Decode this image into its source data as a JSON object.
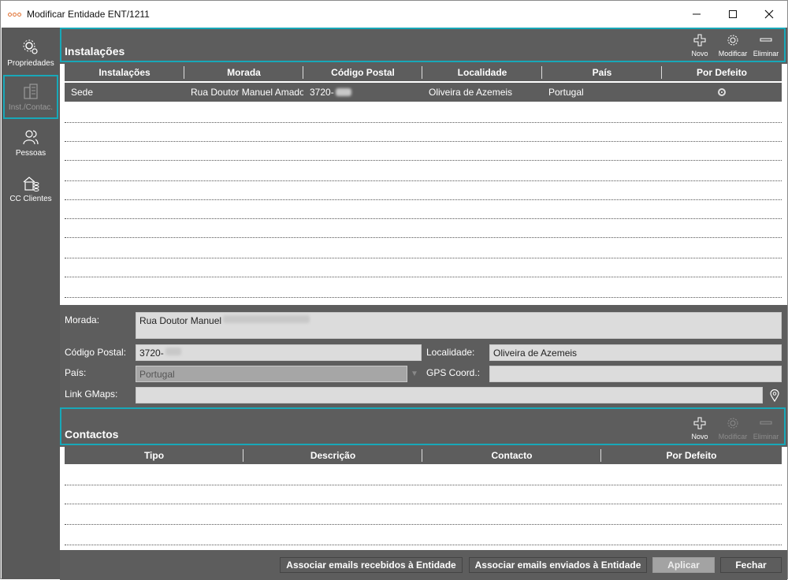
{
  "window": {
    "title": "Modificar Entidade ENT/1211",
    "controls": [
      "minimize-icon",
      "maximize-icon",
      "close-icon"
    ]
  },
  "sidebar": {
    "items": [
      {
        "label": "Propriedades",
        "icon": "gears-icon"
      },
      {
        "label": "Inst./Contac.",
        "icon": "building-icon",
        "active": true
      },
      {
        "label": "Pessoas",
        "icon": "people-icon"
      },
      {
        "label": "CC Clientes",
        "icon": "cc-icon"
      }
    ]
  },
  "instalacoes": {
    "title": "Instalações",
    "tools": {
      "novo": "Novo",
      "modificar": "Modificar",
      "eliminar": "Eliminar"
    },
    "columns": [
      "Instalações",
      "Morada",
      "Código Postal",
      "Localidade",
      "País",
      "Por Defeito"
    ],
    "rows": [
      {
        "instalacao": "Sede",
        "morada": "Rua Doutor Manuel Amado",
        "codigo_postal": "3720-",
        "localidade": "Oliveira de Azemeis",
        "pais": "Portugal",
        "por_defeito": true
      }
    ]
  },
  "form": {
    "morada_label": "Morada:",
    "morada_value": "Rua Doutor Manuel",
    "codigo_postal_label": "Código Postal:",
    "codigo_postal_value": "3720-",
    "localidade_label": "Localidade:",
    "localidade_value": "Oliveira de Azemeis",
    "pais_label": "País:",
    "pais_value": "Portugal",
    "gps_label": "GPS Coord.:",
    "gps_value": "",
    "gmaps_label": "Link GMaps:",
    "gmaps_value": ""
  },
  "contactos": {
    "title": "Contactos",
    "tools": {
      "novo": "Novo",
      "modificar": "Modificar",
      "eliminar": "Eliminar"
    },
    "columns": [
      "Tipo",
      "Descrição",
      "Contacto",
      "Por Defeito"
    ]
  },
  "footer": {
    "assoc_recebidos": "Associar emails recebidos à Entidade",
    "assoc_enviados": "Associar emails enviados à Entidade",
    "aplicar": "Aplicar",
    "fechar": "Fechar"
  },
  "colors": {
    "accent": "#18a8b8",
    "panel": "#5d5d5d"
  }
}
